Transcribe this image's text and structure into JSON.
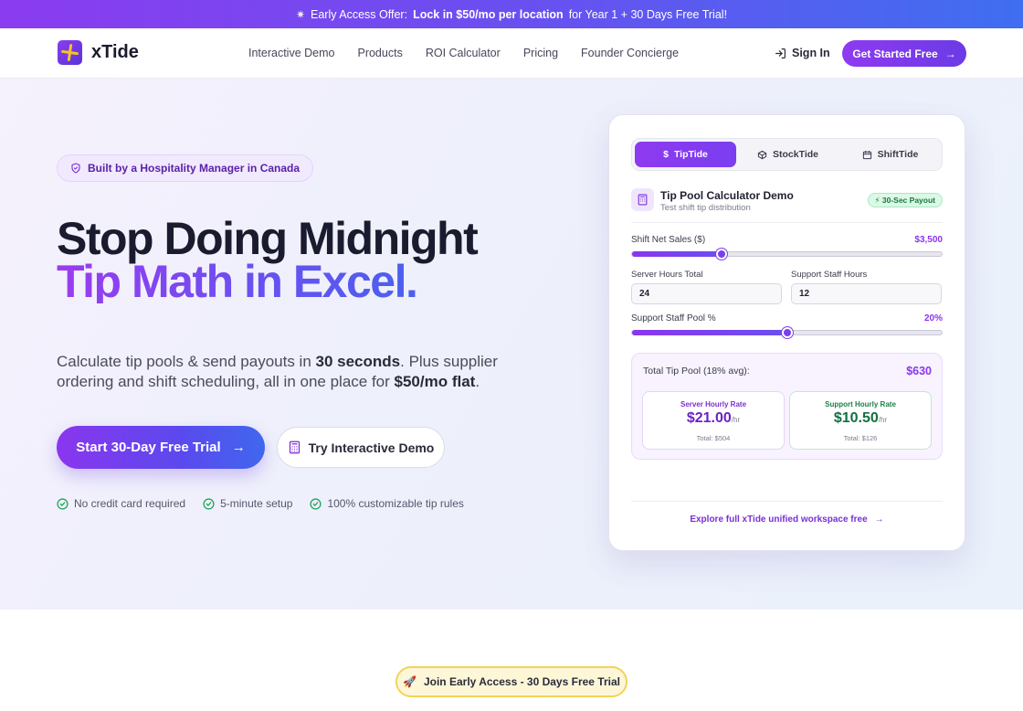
{
  "promo": {
    "lead": "Early Access Offer:",
    "bold": "Lock in $50/mo per location",
    "tail": "for Year 1 + 30 Days Free Trial!"
  },
  "nav": {
    "brand": "xTide",
    "links": [
      "Interactive Demo",
      "Products",
      "ROI Calculator",
      "Pricing",
      "Founder Concierge"
    ],
    "sign_in": "Sign In",
    "cta": "Get Started Free"
  },
  "hero": {
    "badge": "Built by a Hospitality Manager in Canada",
    "title_line1": "Stop Doing Midnight",
    "title_line2": "Tip Math in Excel.",
    "sub_1": "Calculate tip pools & send payouts in ",
    "sub_b1": "30 seconds",
    "sub_2": ". Plus supplier ordering and shift scheduling, all in one place for ",
    "sub_b2": "$50/mo flat",
    "sub_3": ".",
    "cta_primary": "Start 30-Day Free Trial",
    "cta_secondary": "Try Interactive Demo",
    "checks": [
      "No credit card required",
      "5-minute setup",
      "100% customizable tip rules"
    ]
  },
  "card": {
    "tabs": [
      "TipTide",
      "StockTide",
      "ShiftTide"
    ],
    "active_tab": 0,
    "title": "Tip Pool Calculator Demo",
    "subtitle": "Test shift tip distribution",
    "payout_badge": "⚡ 30-Sec Payout",
    "sales_label": "Shift Net Sales ($)",
    "sales_value": "$3,500",
    "sales_fraction": 0.29,
    "server_hours_label": "Server Hours Total",
    "server_hours_value": "24",
    "support_hours_label": "Support Staff Hours",
    "support_hours_value": "12",
    "pool_pct_label": "Support Staff Pool %",
    "pool_pct_value": "20%",
    "pool_pct_fraction": 0.5,
    "total_label": "Total Tip Pool (18% avg):",
    "total_value": "$630",
    "server_rate_label": "Server Hourly Rate",
    "server_rate_value": "$21.00",
    "server_rate_unit": "/hr",
    "server_total": "Total: $504",
    "support_rate_label": "Support Hourly Rate",
    "support_rate_value": "$10.50",
    "support_rate_unit": "/hr",
    "support_total": "Total: $126",
    "explore": "Explore full xTide unified workspace free"
  },
  "join": {
    "label": "Join Early Access - 30 Days Free Trial"
  },
  "colors": {
    "accent": "#8a36ee",
    "accent_blue": "#3f67ee",
    "success": "#22a55a"
  }
}
